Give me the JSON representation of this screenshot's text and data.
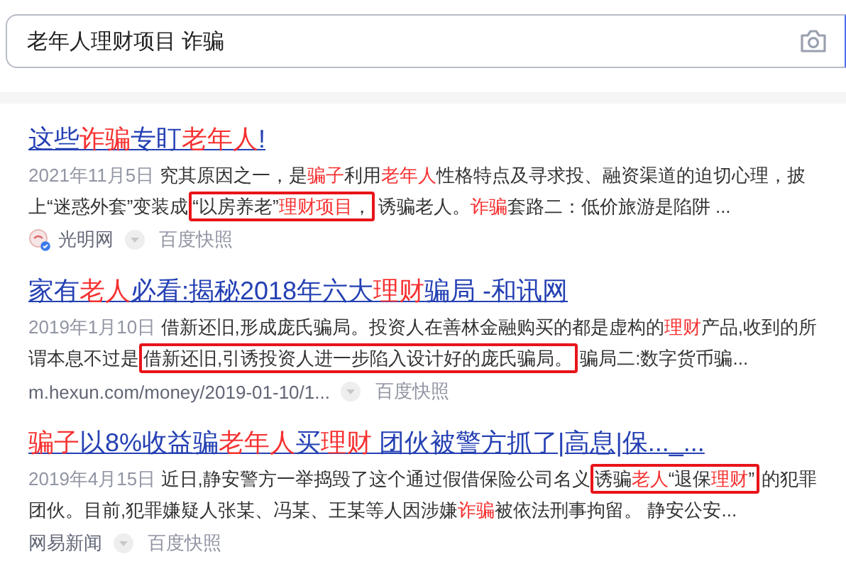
{
  "search": {
    "value": "老年人理财项目 诈骗"
  },
  "results": [
    {
      "title": [
        {
          "text": "这些",
          "red": false
        },
        {
          "text": "诈骗",
          "red": true
        },
        {
          "text": "专盯",
          "red": false
        },
        {
          "text": "老年人",
          "red": true
        },
        {
          "text": "!",
          "red": false
        }
      ],
      "date": "2021年11月5日",
      "snippet": [
        {
          "kind": "text",
          "text": "究其原因之一，是",
          "red": false
        },
        {
          "kind": "text",
          "text": "骗子",
          "red": true
        },
        {
          "kind": "text",
          "text": "利用",
          "red": false
        },
        {
          "kind": "text",
          "text": "老年人",
          "red": true
        },
        {
          "kind": "text",
          "text": "性格特点及寻求投、融资渠道的迫切心理，披上“迷惑外套”变装成",
          "red": false
        },
        {
          "kind": "box",
          "runs": [
            {
              "text": "“以房养老”",
              "red": false
            },
            {
              "text": "理财项目",
              "red": true
            },
            {
              "text": "，",
              "red": false
            }
          ]
        },
        {
          "kind": "text",
          "text": "诱骗老人。",
          "red": false
        },
        {
          "kind": "text",
          "text": "诈骗",
          "red": true
        },
        {
          "kind": "text",
          "text": "套路二：低价旅游是陷阱 ...",
          "red": false
        }
      ],
      "source": "光明网",
      "source_logo": true,
      "snapshot": "百度快照"
    },
    {
      "title": [
        {
          "text": "家有",
          "red": false
        },
        {
          "text": "老人",
          "red": true
        },
        {
          "text": "必看:揭秘2018年六大",
          "red": false
        },
        {
          "text": "理财",
          "red": true
        },
        {
          "text": "骗局 -和讯网",
          "red": false
        }
      ],
      "date": "2019年1月10日",
      "snippet": [
        {
          "kind": "text",
          "text": "借新还旧,形成庞氏骗局。投资人在善林金融购买的都是虚构的",
          "red": false
        },
        {
          "kind": "text",
          "text": "理财",
          "red": true
        },
        {
          "kind": "text",
          "text": "产品,收到的所谓本息不过是",
          "red": false
        },
        {
          "kind": "box",
          "runs": [
            {
              "text": "借新还旧,引诱投资人进一步陷入设计好的庞氏骗局。",
              "red": false
            }
          ]
        },
        {
          "kind": "text",
          "text": "骗局二:数字货币骗...",
          "red": false
        }
      ],
      "source": "m.hexun.com/money/2019-01-10/1...",
      "source_logo": false,
      "snapshot": "百度快照"
    },
    {
      "title": [
        {
          "text": "骗子",
          "red": true
        },
        {
          "text": "以8%收益骗",
          "red": false
        },
        {
          "text": "老年人",
          "red": true
        },
        {
          "text": "买",
          "red": false
        },
        {
          "text": "理财",
          "red": true
        },
        {
          "text": " 团伙被警方抓了|高息|保..._...",
          "red": false
        }
      ],
      "date": "2019年4月15日",
      "snippet": [
        {
          "kind": "text",
          "text": "近日,静安警方一举捣毁了这个通过假借保险公司名义",
          "red": false
        },
        {
          "kind": "box",
          "runs": [
            {
              "text": "诱骗",
              "red": false
            },
            {
              "text": "老人",
              "red": true
            },
            {
              "text": "“退保",
              "red": false
            },
            {
              "text": "理财",
              "red": true
            },
            {
              "text": "”",
              "red": false
            }
          ]
        },
        {
          "kind": "text",
          "text": "的犯罪团伙。目前,犯罪嫌疑人张某、冯某、王某等人因涉嫌",
          "red": false
        },
        {
          "kind": "text",
          "text": "诈骗",
          "red": true
        },
        {
          "kind": "text",
          "text": "被依法刑事拘留。 静安公安...",
          "red": false
        }
      ],
      "source": "网易新闻",
      "source_logo": false,
      "snapshot": "百度快照"
    }
  ]
}
